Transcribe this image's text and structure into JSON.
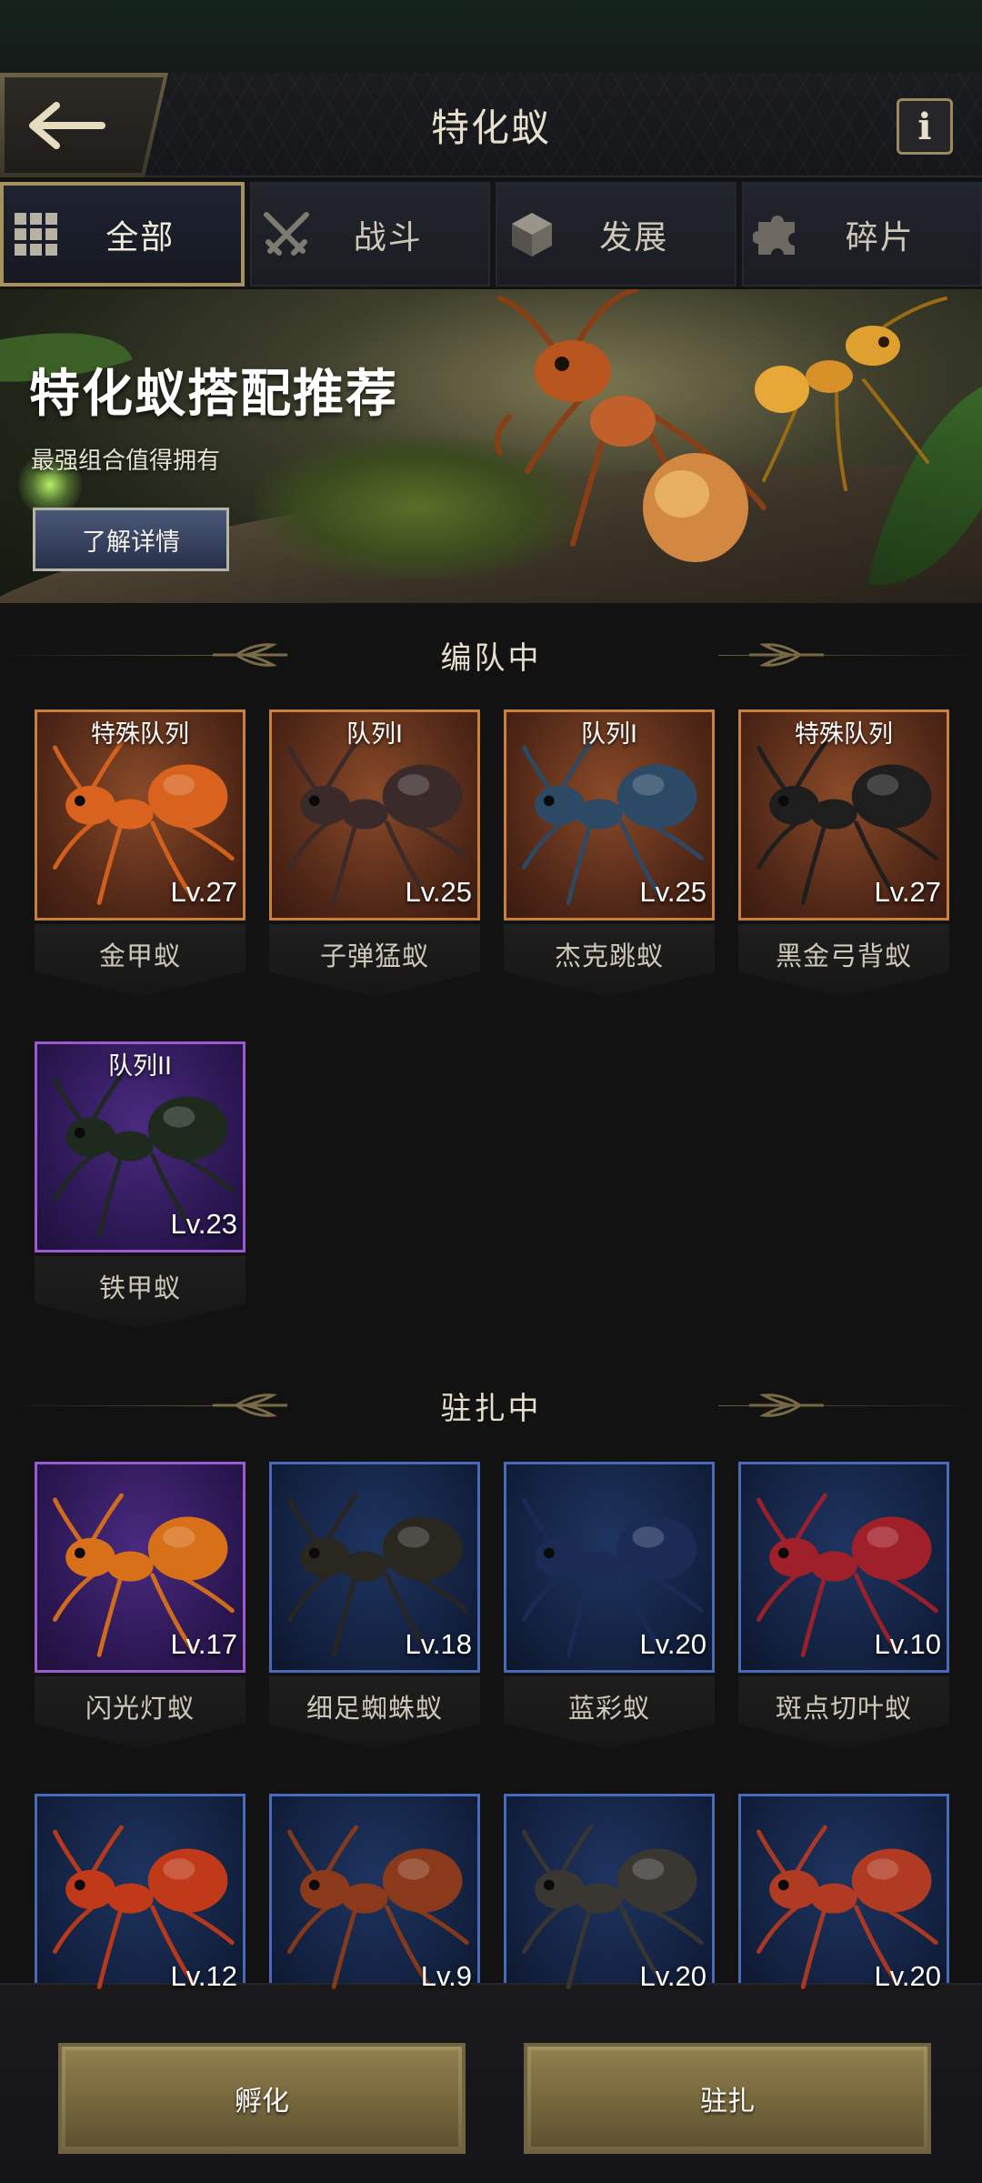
{
  "header": {
    "title": "特化蚁",
    "back_icon": "back-arrow-icon",
    "info_label": "i"
  },
  "tabs": [
    {
      "label": "全部",
      "icon": "grid-icon",
      "active": true
    },
    {
      "label": "战斗",
      "icon": "crossed-swords-icon",
      "active": false
    },
    {
      "label": "发展",
      "icon": "cube-icon",
      "active": false
    },
    {
      "label": "碎片",
      "icon": "puzzle-icon",
      "active": false
    }
  ],
  "banner": {
    "title": "特化蚁搭配推荐",
    "subtitle": "最强组合值得拥有",
    "button_label": "了解详情"
  },
  "sections": {
    "in_formation": "编队中",
    "stationed": "驻扎中"
  },
  "formation_cards": [
    {
      "tag": "特殊队列",
      "level": "Lv.27",
      "name": "金甲蚁",
      "rarity": "orange",
      "ant_color": "#d8621e"
    },
    {
      "tag": "队列I",
      "level": "Lv.25",
      "name": "子弹猛蚁",
      "rarity": "orange",
      "ant_color": "#3a2a2a"
    },
    {
      "tag": "队列I",
      "level": "Lv.25",
      "name": "杰克跳蚁",
      "rarity": "orange",
      "ant_color": "#2c4a66"
    },
    {
      "tag": "特殊队列",
      "level": "Lv.27",
      "name": "黑金弓背蚁",
      "rarity": "orange",
      "ant_color": "#1e1e1e"
    },
    {
      "tag": "队列II",
      "level": "Lv.23",
      "name": "铁甲蚁",
      "rarity": "purple",
      "ant_color": "#1e2a1e"
    }
  ],
  "stationed_cards": [
    {
      "level": "Lv.17",
      "name": "闪光灯蚁",
      "rarity": "purple",
      "ant_color": "#d8701a"
    },
    {
      "level": "Lv.18",
      "name": "细足蜘蛛蚁",
      "rarity": "blue",
      "ant_color": "#2a2620"
    },
    {
      "level": "Lv.20",
      "name": "蓝彩蚁",
      "rarity": "blue",
      "ant_color": "#1c2a56"
    },
    {
      "level": "Lv.10",
      "name": "斑点切叶蚁",
      "rarity": "blue",
      "ant_color": "#a0202a"
    },
    {
      "level": "Lv.12",
      "name": "",
      "rarity": "blue",
      "ant_color": "#c03a1a"
    },
    {
      "level": "Lv.9",
      "name": "",
      "rarity": "blue",
      "ant_color": "#8a3a1a"
    },
    {
      "level": "Lv.20",
      "name": "",
      "rarity": "blue",
      "ant_color": "#3a3632"
    },
    {
      "level": "Lv.20",
      "name": "",
      "rarity": "blue",
      "ant_color": "#b03a22"
    }
  ],
  "bottom": {
    "hatch_label": "孵化",
    "station_label": "驻扎"
  },
  "colors": {
    "accent_gold": "#a6925c",
    "frame_orange": "#c9803e",
    "frame_purple": "#9a5ad0",
    "frame_blue": "#4a6ab8"
  }
}
